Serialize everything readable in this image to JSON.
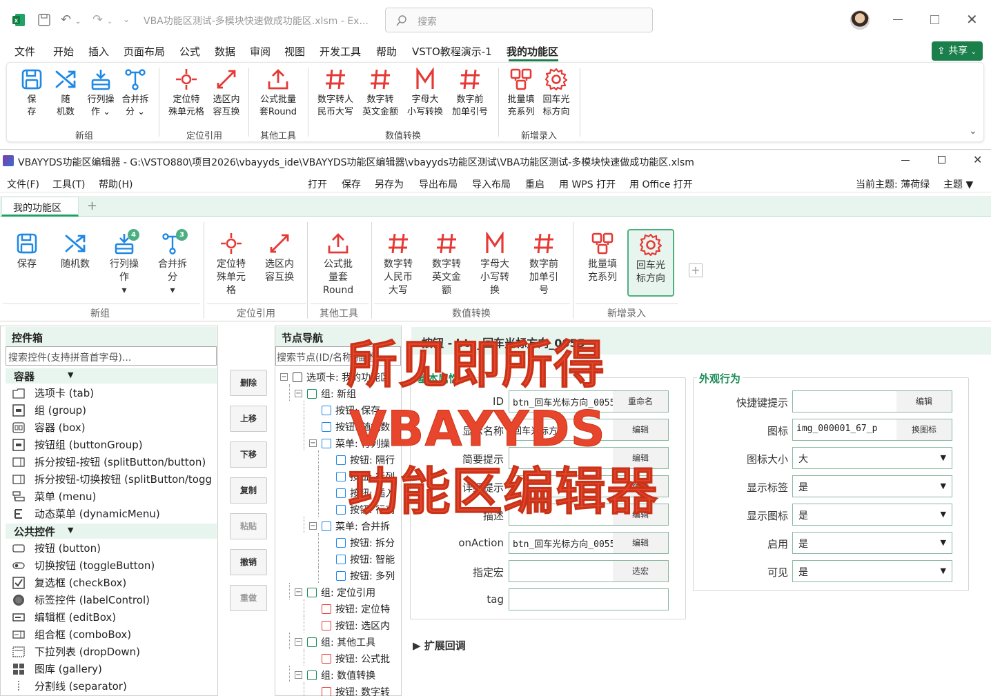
{
  "excel": {
    "title": "VBA功能区测试-多模块快速做成功能区.xlsm - Ex...",
    "search_placeholder": "搜索",
    "share_label": "共享",
    "menu": [
      "文件",
      "开始",
      "插入",
      "页面布局",
      "公式",
      "数据",
      "审阅",
      "视图",
      "开发工具",
      "帮助",
      "VSTO教程演示-1",
      "我的功能区"
    ],
    "ribbon": {
      "buttons": [
        {
          "label": "保\n存"
        },
        {
          "label": "随\n机数"
        },
        {
          "label": "行列操\n作 ⌄"
        },
        {
          "label": "合并拆\n分 ⌄"
        },
        {
          "label": "定位特\n殊单元格"
        },
        {
          "label": "选区内\n容互换"
        },
        {
          "label": "公式批量\n套Round"
        },
        {
          "label": "数字转人\n民币大写"
        },
        {
          "label": "数字转\n英文金额"
        },
        {
          "label": "字母大\n小写转换"
        },
        {
          "label": "数字前\n加单引号"
        },
        {
          "label": "批量填\n充系列"
        },
        {
          "label": "回车光\n标方向"
        }
      ],
      "groups": [
        "新组",
        "定位引用",
        "其他工具",
        "数值转换",
        "新增录入"
      ]
    }
  },
  "editor": {
    "title": "VBAYYDS功能区编辑器 - G:\\VSTO880\\项目2026\\vbayyds_ide\\VBAYYDS功能区编辑器\\vbayyds功能区测试\\VBA功能区测试-多模块快速做成功能区.xlsm",
    "menu_left": [
      "文件(F)",
      "工具(T)",
      "帮助(H)"
    ],
    "menu_center": [
      "打开",
      "保存",
      "另存为",
      "导出布局",
      "导入布局",
      "重启",
      "用 WPS 打开",
      "用 Office 打开"
    ],
    "theme_label": "当前主题: 薄荷绿",
    "theme_menu": "主题 ▼",
    "tab": "我的功能区",
    "tab_add": "+",
    "ribbon": {
      "buttons": [
        {
          "label": "保存"
        },
        {
          "label": "随机数"
        },
        {
          "label": "行列操\n作\n▾",
          "badge": "4"
        },
        {
          "label": "合并拆\n分\n▾",
          "badge": "3"
        },
        {
          "label": "定位特\n殊单元\n格"
        },
        {
          "label": "选区内\n容互换"
        },
        {
          "label": "公式批\n量套\nRound"
        },
        {
          "label": "数字转\n人民币\n大写"
        },
        {
          "label": "数字转\n英文金\n额"
        },
        {
          "label": "字母大\n小写转\n换"
        },
        {
          "label": "数字前\n加单引\n号"
        },
        {
          "label": "批量填\n充系列"
        },
        {
          "label": "回车光\n标方向"
        }
      ],
      "groups": [
        "新组",
        "定位引用",
        "其他工具",
        "数值转换",
        "新增录入"
      ]
    },
    "toolbox": {
      "title": "控件箱",
      "search_placeholder": "搜索控件(支持拼音首字母)...",
      "sections": [
        {
          "name": "容器",
          "items": [
            "选项卡  (tab)",
            "组  (group)",
            "容器  (box)",
            "按钮组  (buttonGroup)",
            "拆分按钮-按钮 (splitButton/button)",
            "拆分按钮-切换按钮 (splitButton/togg",
            "菜单  (menu)",
            "动态菜单  (dynamicMenu)"
          ]
        },
        {
          "name": "公共控件",
          "items": [
            "按钮  (button)",
            "切换按钮  (toggleButton)",
            "复选框  (checkBox)",
            "标签控件  (labelControl)",
            "编辑框  (editBox)",
            "组合框  (comboBox)",
            "下拉列表  (dropDown)",
            "图库  (gallery)",
            "分割线  (separator)"
          ]
        }
      ]
    },
    "actions": [
      "删除",
      "上移",
      "下移",
      "复制",
      "粘贴",
      "撤销",
      "重做"
    ],
    "nav": {
      "title": "节点导航",
      "search_placeholder": "搜索节点(ID/名称/描述)",
      "items": [
        "选项卡: 我的功能区",
        "组: 新组",
        "按钮: 保存",
        "按钮: 随机数",
        "菜单: 行列操",
        "按钮: 隔行",
        "按钮: 行列",
        "按钮: 插入",
        "按钮: 行高",
        "菜单: 合并拆",
        "按钮: 拆分",
        "按钮: 智能",
        "按钮: 多列",
        "组: 定位引用",
        "按钮: 定位特",
        "按钮: 选区内",
        "组: 其他工具",
        "按钮: 公式批",
        "组: 数值转换",
        "按钮: 数字转"
      ]
    },
    "props": {
      "header": "按钮 - btn_回车光标方向_0055",
      "basic_title": "基本属性",
      "fields": [
        {
          "label": "ID",
          "value": "btn_回车光标方向_0055",
          "action": "重命名"
        },
        {
          "label": "显示名称",
          "value": "回车光标方向",
          "action": "编辑"
        },
        {
          "label": "简要提示",
          "value": "",
          "action": "编辑"
        },
        {
          "label": "详细提示",
          "value": "",
          "action": "编辑"
        },
        {
          "label": "描述",
          "value": "",
          "action": "编辑"
        },
        {
          "label": "onAction",
          "value": "btn_回车光标方向_0055",
          "action": "编辑"
        },
        {
          "label": "指定宏",
          "value": "",
          "action": "选宏"
        },
        {
          "label": "tag",
          "value": "",
          "action": ""
        }
      ],
      "appearance_title": "外观行为",
      "appearance": [
        {
          "label": "快捷键提示",
          "value": "",
          "action": "编辑"
        },
        {
          "label": "图标",
          "value": "img_000001_67_p",
          "action": "换图标"
        },
        {
          "label": "图标大小",
          "value": "大",
          "select": true
        },
        {
          "label": "显示标签",
          "value": "是",
          "select": true
        },
        {
          "label": "显示图标",
          "value": "是",
          "select": true
        },
        {
          "label": "启用",
          "value": "是",
          "select": true
        },
        {
          "label": "可见",
          "value": "是",
          "select": true
        }
      ],
      "expand_label": "▶ 扩展回调"
    },
    "overlay": [
      "所见即所得",
      "VBAYYDS",
      "功能区编辑器"
    ]
  },
  "colors": {
    "accent": "#1aa260",
    "icon_blue": "#1e88e5",
    "icon_red": "#e53935",
    "mint": "#e8f5ee",
    "overlay": "#e8452d"
  }
}
